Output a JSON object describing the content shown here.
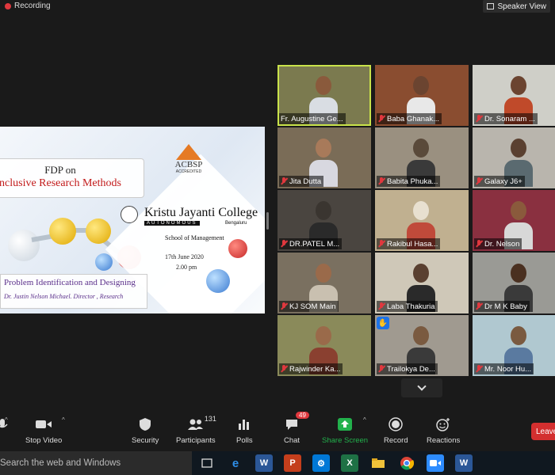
{
  "top": {
    "recording_label": "Recording",
    "speaker_view_label": "Speaker View"
  },
  "slide": {
    "fdp": "FDP on",
    "title": "nclusive Research Methods",
    "acbsp": "ACBSP",
    "accredited": "ACCREDITED",
    "college": "Kristu Jayanti College",
    "autonomous": "AUTONOMOUS",
    "city": "Bengaluru",
    "school": "School of Management",
    "date": "17th June 2020",
    "time": "2.00 pm",
    "topic": "Problem Identification and Designing",
    "speaker": "Dr. Justin Nelson Michael. Director , Research"
  },
  "participants": [
    {
      "name": "Fr. Augustine Ge...",
      "muted": false,
      "active": true,
      "bg": "#7b7a4f",
      "skin": "#8a5a3c",
      "shirt": "#d9dde3",
      "video": true
    },
    {
      "name": "Baba Ghanak...",
      "muted": true,
      "active": false,
      "bg": "#8a4d30",
      "skin": "#6b4430",
      "shirt": "#e8e8e8",
      "video": true
    },
    {
      "name": "Dr. Sonaram ...",
      "muted": true,
      "active": false,
      "bg": "#cfcfc8",
      "skin": "#6b4430",
      "shirt": "#c04a2a",
      "video": true
    },
    {
      "name": "Jita Dutta",
      "muted": true,
      "active": false,
      "bg": "#7a6c57",
      "skin": "#a87a5a",
      "shirt": "#d8d8e0",
      "video": true
    },
    {
      "name": "Babita Phuka...",
      "muted": true,
      "active": false,
      "bg": "#9a9080",
      "skin": "#5a4a3a",
      "shirt": "#3a3a3a",
      "video": true
    },
    {
      "name": "Galaxy J6+",
      "muted": true,
      "active": false,
      "bg": "#b9b5ad",
      "skin": "#5a4030",
      "shirt": "#5a6a70",
      "video": true
    },
    {
      "name": "DR.PATEL M...",
      "muted": true,
      "active": false,
      "bg": "#4a4540",
      "skin": "#3a3530",
      "shirt": "#2a2a2a",
      "video": true
    },
    {
      "name": "Rakibul Hasa...",
      "muted": true,
      "active": false,
      "bg": "#c0b090",
      "skin": "#e8e0d0",
      "shirt": "#c04a3a",
      "video": true
    },
    {
      "name": "Dr. Nelson",
      "muted": true,
      "active": false,
      "bg": "#8a3040",
      "skin": "#8a5a3c",
      "shirt": "#d8d8d8",
      "video": true
    },
    {
      "name": "KJ SOM Main",
      "muted": true,
      "active": false,
      "bg": "#7a7060",
      "skin": "#9a6a4a",
      "shirt": "#c9c0b0",
      "video": true
    },
    {
      "name": "Laba Thakuria",
      "muted": true,
      "active": false,
      "bg": "#cfc8b8",
      "skin": "#5a4030",
      "shirt": "#2a2a2a",
      "video": true
    },
    {
      "name": "Dr M K Baby",
      "muted": true,
      "active": false,
      "bg": "#9a9a95",
      "skin": "#4a3020",
      "shirt": "#3a3a3a",
      "video": true
    },
    {
      "name": "Rajwinder Ka...",
      "muted": true,
      "active": false,
      "bg": "#8a8a5a",
      "skin": "#9a6a4a",
      "shirt": "#8a4030",
      "video": true
    },
    {
      "name": "Trailokya De...",
      "muted": true,
      "active": false,
      "bg": "#a09a90",
      "skin": "#7a5a40",
      "shirt": "#3a3a3a",
      "video": true
    },
    {
      "name": "Mr. Noor Hu...",
      "muted": true,
      "active": false,
      "bg": "#b0c8d0",
      "skin": "#7a5a40",
      "shirt": "#5a7aa0",
      "video": true
    }
  ],
  "hand_raised_icon": "raise-hand-icon",
  "toolbar": {
    "stop_video": "Stop Video",
    "security": "Security",
    "participants": "Participants",
    "participants_count": "131",
    "polls": "Polls",
    "chat": "Chat",
    "chat_badge": "49",
    "share_screen": "Share Screen",
    "record": "Record",
    "reactions": "Reactions",
    "leave": "Leave"
  },
  "taskbar": {
    "search_placeholder": "Search the web and Windows"
  },
  "colors": {
    "share_green": "#22b14c",
    "leave_red": "#d32f2f",
    "active_speaker": "#c9e34a",
    "muted_red": "#e0383e"
  }
}
